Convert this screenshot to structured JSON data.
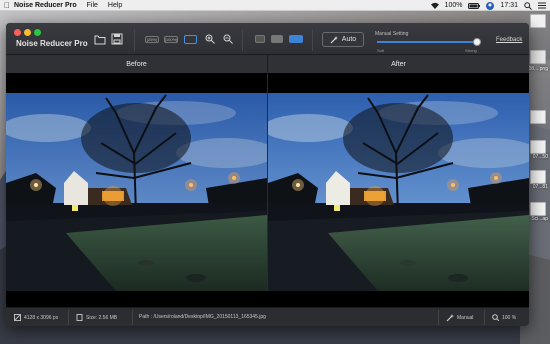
{
  "menubar": {
    "apple_icon": "apple-icon",
    "app_name": "Noise Reducer Pro",
    "items": [
      "File",
      "Help"
    ],
    "time": "17:31",
    "battery": "100%"
  },
  "window": {
    "title": "Noise Reducer Pro",
    "zoom_labels": [
      "[25%]",
      "[100%]"
    ],
    "auto_label": "Auto",
    "manual_setting_label": "Manual Setting",
    "slider": {
      "min_label": "Soft",
      "max_label": "Strong",
      "value": 1.0
    },
    "feedback_label": "Feedback"
  },
  "compare": {
    "before_label": "Before",
    "after_label": "After"
  },
  "status": {
    "dimensions": "4128 x 3096 px",
    "size": "Size: 2.56 MB",
    "path": "Path : /Users/roland/Desktop/IMG_20150113_165345.jpg",
    "mode": "Manual",
    "zoom": "100 %"
  },
  "desktop_labels": [
    "08....png",
    "07...50",
    "07...81",
    "Sci...ap"
  ],
  "colors": {
    "accent": "#3e84d6",
    "window_bg": "#2b2c30",
    "toolbar_bg": "#3a3b40"
  }
}
